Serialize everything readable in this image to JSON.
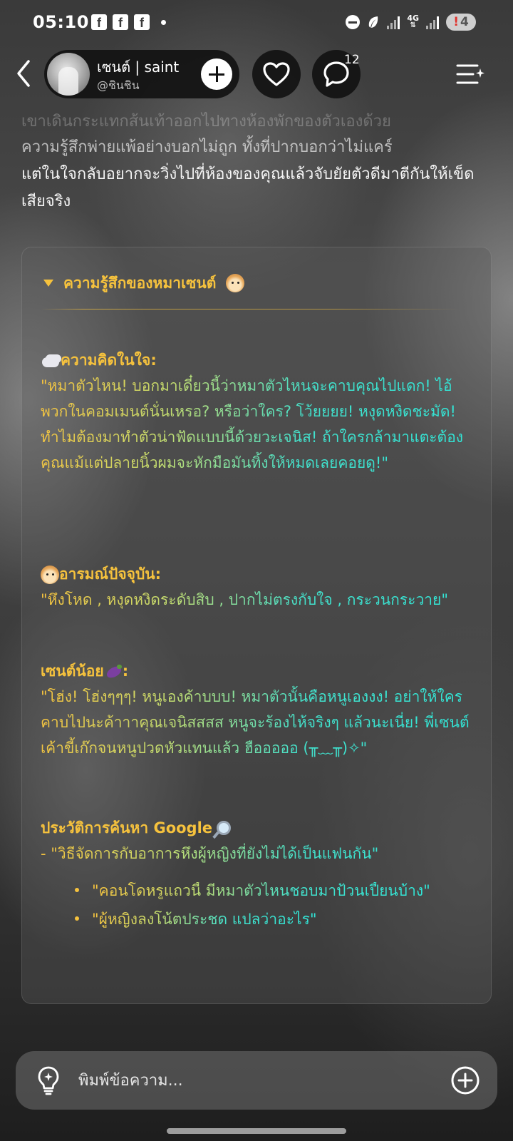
{
  "status_bar": {
    "time": "05:10",
    "network_type": "4G",
    "battery_level": "4",
    "battery_alert": "!"
  },
  "header": {
    "profile_name": "เซนต์ | saint",
    "profile_handle": "@ชินชิน",
    "comment_count": "12"
  },
  "story": {
    "line_faded_top": "เขาเดินกระแทกส้นเท้าออกไปทางห้องพักของตัวเองด้วย",
    "line_faded": "ความรู้สึกพ่ายแพ้อย่างบอกไม่ถูก ทั้งที่ปากบอกว่าไม่แคร์",
    "line_full": "แต่ในใจกลับอยากจะวิ่งไปที่ห้องของคุณแล้วจับยัยตัวดีมาตีกันให้เข็ดเสียจริง"
  },
  "feelings": {
    "title": "ความรู้สึกของหมาเซนต์",
    "thought_title": "ความคิดในใจ:",
    "thought_body": "\"หมาตัวไหน! บอกมาเดี๋ยวนี้ว่าหมาตัวไหนจะคาบคุณไปแดก! ไอ้พวกในคอมเมนต์นั่นเหรอ? หรือว่าใคร? โว้ยยยย! หงุดหงิดชะมัด! ทำไมต้องมาทำตัวน่าฟัดแบบนี้ด้วยวะเจนิส! ถ้าใครกล้ามาแตะต้องคุณแม้แต่ปลายนิ้วผมจะหักมือมันทิ้งให้หมดเลยคอยดู!\"",
    "mood_title": "อารมณ์ปัจจุบัน:",
    "mood_body": "\"หึงโหด , หงุดหงิดระดับสิบ , ปากไม่ตรงกับใจ , กระวนกระวาย\"",
    "little_title": "เซนต์น้อย",
    "little_title_suffix": ":",
    "little_body": "\"โฮ่ง! โฮ่งๆๆๆ! หนูเองค้าบบบ! หมาตัวนั้นคือหนูเองงง! อย่าให้ใครคาบไปนะค้าาาคุณเจนิสสสส หนูจะร้องไห้จริงๆ แล้วนะเนี่ย! พี่เซนต์เค้าขี้เก๊กจนหนูปวดหัวแทนแล้ว ฮือออออ (╥﹏╥)✧\"",
    "search_title": "ประวัติการค้นหา Google",
    "search_items": [
      "- \"วิธีจัดการกับอาการหึงผู้หญิงที่ยังไม่ได้เป็นแฟนกัน\"",
      "\"คอนโดหรูแถวนี้ มีหมาตัวไหนชอบมาป้วนเปี้ยนบ้าง\"",
      "\"ผู้หญิงลงโน้ตประชด แปลว่าอะไร\""
    ]
  },
  "composer": {
    "placeholder": "พิมพ์ข้อความ..."
  },
  "colors": {
    "accent_gold": "#f6c23d",
    "accent_cyan": "#2fe6d8",
    "battery_alert_red": "#e0322d"
  },
  "icons": [
    "back-arrow-icon",
    "plus-icon",
    "heart-icon",
    "comment-icon",
    "menu-sparkle-icon",
    "caret-down-icon",
    "puppy-emoji",
    "thought-cloud-emoji",
    "eggplant-emoji",
    "magnifier-emoji",
    "lightbulb-icon",
    "add-circle-icon"
  ]
}
